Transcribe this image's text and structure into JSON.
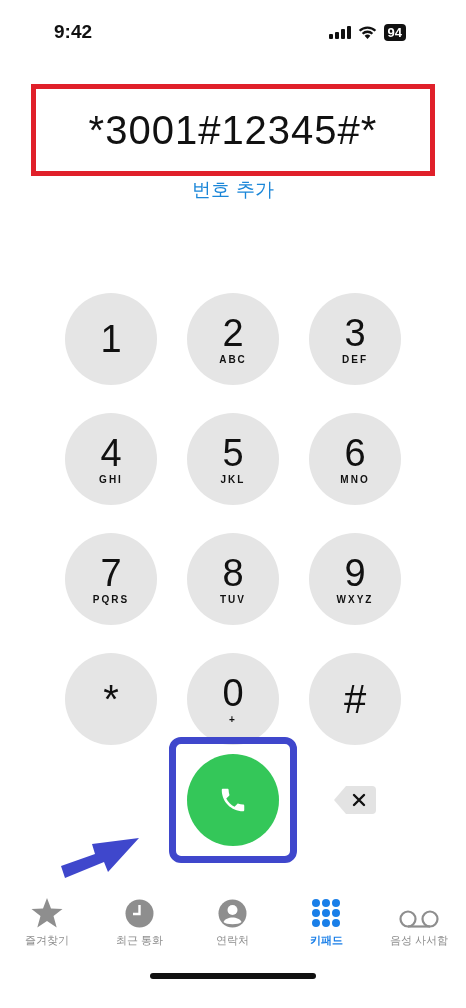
{
  "status_bar": {
    "time": "9:42",
    "battery": "94"
  },
  "number_display": {
    "text": "*3001#12345#*",
    "highlighted": true
  },
  "add_number_link": "번호 추가",
  "keys": [
    {
      "digit": "1"
    },
    {
      "digit": "2",
      "letters": "ABC"
    },
    {
      "digit": "3",
      "letters": "DEF"
    },
    {
      "digit": "4",
      "letters": "GHI"
    },
    {
      "digit": "5",
      "letters": "JKL"
    },
    {
      "digit": "6",
      "letters": "MNO"
    },
    {
      "digit": "7",
      "letters": "PQRS"
    },
    {
      "digit": "8",
      "letters": "TUV"
    },
    {
      "digit": "9",
      "letters": "WXYZ"
    },
    {
      "digit": "*"
    },
    {
      "digit": "0",
      "letters": "+"
    },
    {
      "digit": "#"
    }
  ],
  "call_button": {
    "highlighted": true,
    "pointer_arrow": true
  },
  "tabs": [
    {
      "kind": "star",
      "label": "즐겨찾기",
      "selected": false
    },
    {
      "kind": "clock",
      "label": "최근 통화",
      "selected": false
    },
    {
      "kind": "person",
      "label": "연락처",
      "selected": false
    },
    {
      "kind": "keypad",
      "label": "키패드",
      "selected": true
    },
    {
      "kind": "voicemail",
      "label": "음성 사서함",
      "selected": false
    }
  ]
}
